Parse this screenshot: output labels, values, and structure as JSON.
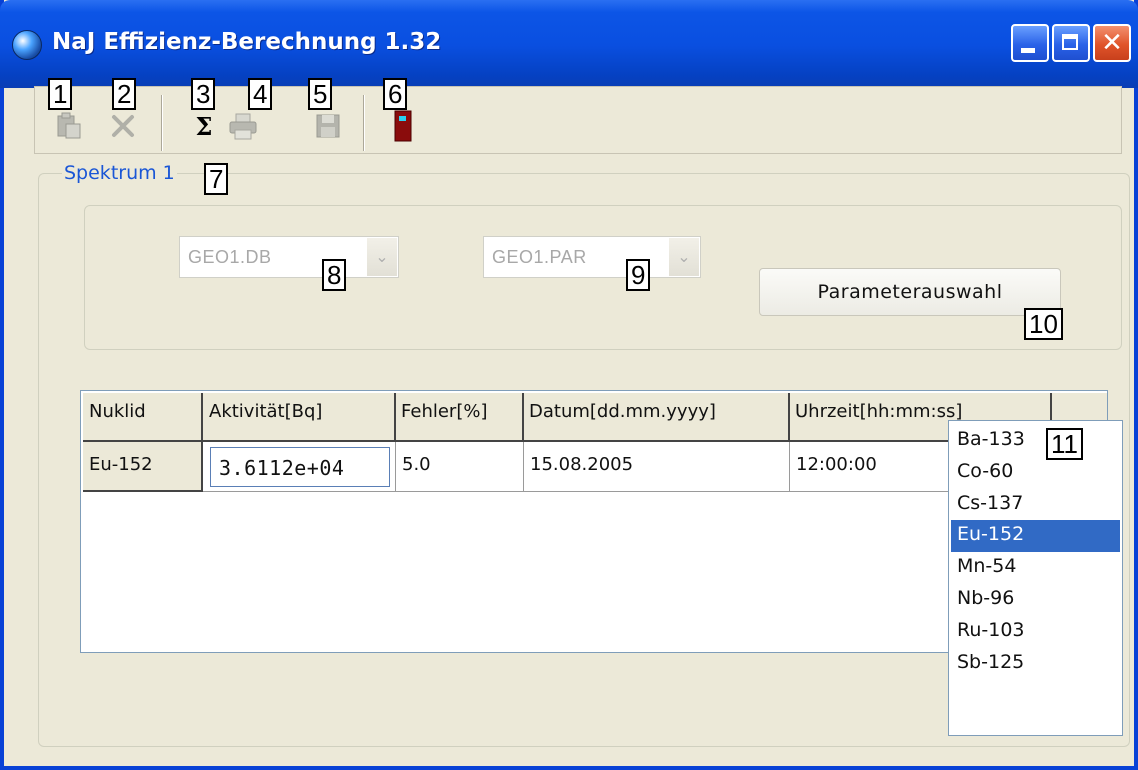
{
  "window": {
    "title": "NaJ Effizienz-Berechnung 1.32",
    "controls": {
      "minimize": "_",
      "maximize": "□",
      "close": "✕"
    }
  },
  "toolbar": {
    "items": [
      {
        "name": "paste",
        "icon": "paste-icon",
        "enabled": false
      },
      {
        "name": "delete",
        "icon": "close-x-icon",
        "enabled": false
      },
      {
        "name": "calculate",
        "icon": "sigma-icon",
        "glyph": "Σ",
        "enabled": true
      },
      {
        "name": "print",
        "icon": "printer-icon",
        "enabled": false
      },
      {
        "name": "save",
        "icon": "floppy-disk-icon",
        "enabled": false
      },
      {
        "name": "exit",
        "icon": "door-exit-icon",
        "enabled": true
      }
    ]
  },
  "annotations": [
    "1",
    "2",
    "3",
    "4",
    "5",
    "6",
    "7",
    "8",
    "9",
    "10",
    "11"
  ],
  "group": {
    "legend": "Spektrum 1",
    "geometry_db": "GEO1.DB",
    "parameter_file": "GEO1.PAR",
    "param_button": "Parameterauswahl"
  },
  "table": {
    "headers": [
      "Nuklid",
      "Aktivität[Bq]",
      "Fehler[%]",
      "Datum[dd.mm.yyyy]",
      "Uhrzeit[hh:mm:ss]"
    ],
    "rows": [
      {
        "nuklid": "Eu-152",
        "aktivitaet": "3.6112e+04",
        "fehler": "5.0",
        "datum": "15.08.2005",
        "uhrzeit": "12:00:00"
      }
    ]
  },
  "nuclide_list": {
    "items": [
      "Ba-133",
      "Co-60",
      "Cs-137",
      "Eu-152",
      "Mn-54",
      "Nb-96",
      "Ru-103",
      "Sb-125"
    ],
    "selected": "Eu-152"
  },
  "colors": {
    "titlebar": "#0a4fe0",
    "legend_text": "#1a56d6",
    "selection": "#316ac5",
    "face": "#ece9d8"
  }
}
